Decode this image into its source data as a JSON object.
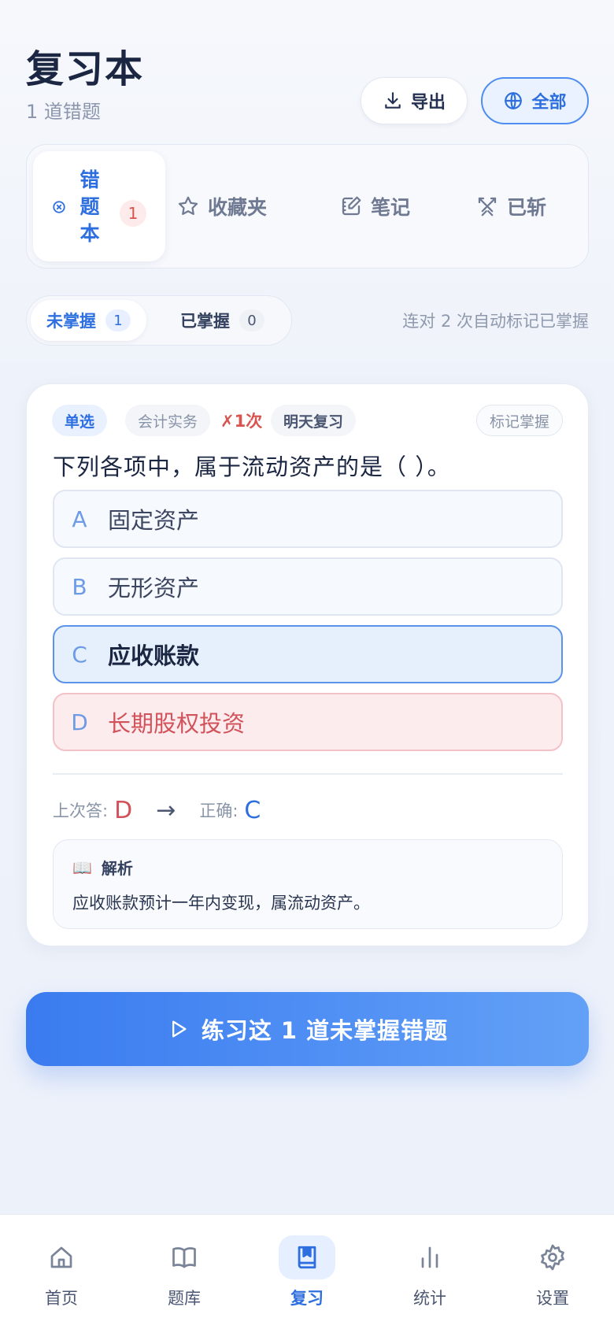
{
  "header": {
    "title": "复习本",
    "subtitle": "1 道错题",
    "export_label": "导出",
    "scope_label": "全部"
  },
  "tabs": [
    {
      "label": "错题本",
      "count": "1",
      "icon": "x-circle-icon"
    },
    {
      "label": "收藏夹",
      "icon": "star-icon"
    },
    {
      "label": "笔记",
      "icon": "note-edit-icon"
    },
    {
      "label": "已斩",
      "icon": "crossed-swords-icon"
    }
  ],
  "segment": {
    "unmastered_label": "未掌握",
    "unmastered_count": "1",
    "mastered_label": "已掌握",
    "mastered_count": "0",
    "auto_hint": "连对 2 次自动标记已掌握"
  },
  "question": {
    "type_chip": "单选",
    "subject_chip": "会计实务",
    "wrong_count": "✗1次",
    "review_chip": "明天复习",
    "mark_label": "标记掌握",
    "text": "下列各项中，属于流动资产的是（ ）。",
    "options": [
      {
        "letter": "A",
        "text": "固定资产",
        "state": "normal"
      },
      {
        "letter": "B",
        "text": "无形资产",
        "state": "normal"
      },
      {
        "letter": "C",
        "text": "应收账款",
        "state": "correct"
      },
      {
        "letter": "D",
        "text": "长期股权投资",
        "state": "wrong"
      }
    ],
    "last_answer_label": "上次答:",
    "last_answer": "D",
    "arrow": "→",
    "correct_label": "正确:",
    "correct_answer": "C",
    "explain_icon": "📖",
    "explain_title": "解析",
    "explain_text": "应收账款预计一年内变现，属流动资产。"
  },
  "practice_button": "练习这 1 道未掌握错题",
  "bottom_nav": [
    {
      "label": "首页",
      "icon": "home-icon"
    },
    {
      "label": "题库",
      "icon": "book-open-icon"
    },
    {
      "label": "复习",
      "icon": "bookmark-book-icon",
      "active": true
    },
    {
      "label": "统计",
      "icon": "bar-chart-icon"
    },
    {
      "label": "设置",
      "icon": "gear-icon"
    }
  ],
  "colors": {
    "accent": "#2e6fe0",
    "wrong": "#d2525b",
    "background": "#f2f5fb"
  }
}
